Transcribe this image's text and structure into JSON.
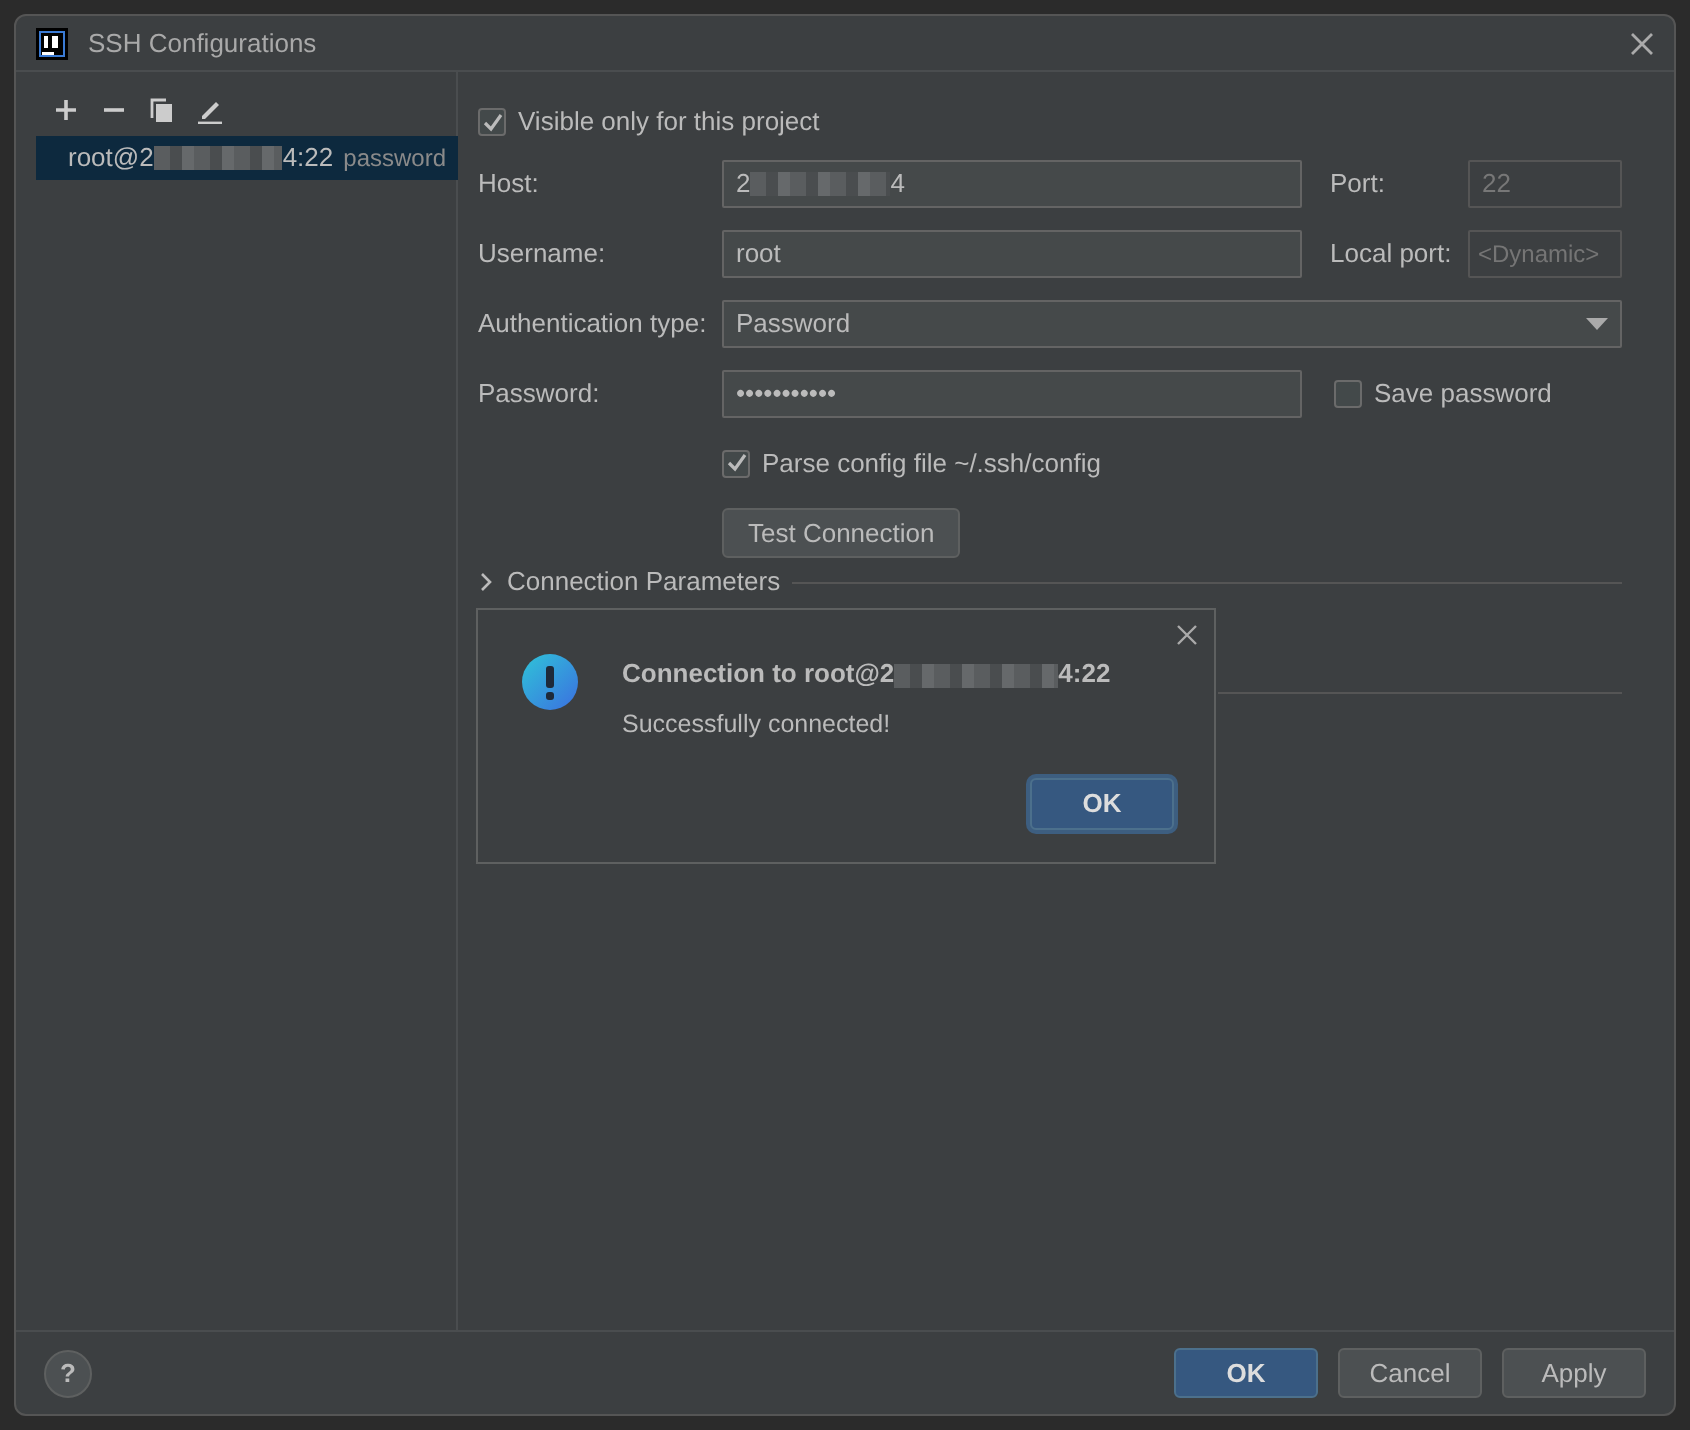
{
  "window": {
    "title": "SSH Configurations"
  },
  "toolbar": [
    {
      "kind": "add"
    },
    {
      "kind": "remove"
    },
    {
      "kind": "copy"
    },
    {
      "kind": "edit"
    }
  ],
  "configs": [
    {
      "prefix": "root@2",
      "suffix": "4:22",
      "auth": "password",
      "selected": true
    }
  ],
  "visible_only": {
    "label": "Visible only for this project",
    "checked": true
  },
  "host": {
    "label": "Host:",
    "prefix": "2",
    "suffix": "4"
  },
  "port": {
    "label": "Port:",
    "value": "22",
    "disabled": true
  },
  "username": {
    "label": "Username:",
    "value": "root"
  },
  "local_port": {
    "label": "Local port:",
    "placeholder": "<Dynamic>"
  },
  "auth_type": {
    "label": "Authentication type:",
    "value": "Password"
  },
  "password": {
    "label": "Password:",
    "value": "•••••••••••"
  },
  "save_password": {
    "label": "Save password",
    "checked": false
  },
  "parse_config": {
    "label": "Parse config file ~/.ssh/config",
    "checked": true
  },
  "test_button": "Test Connection",
  "sections": [
    {
      "title": "Connection Parameters",
      "expanded": false
    }
  ],
  "popup": {
    "title_prefix": "Connection to root@2",
    "title_suffix": "4:22",
    "message": "Successfully connected!",
    "button": "OK"
  },
  "footer": {
    "help": "?",
    "buttons": [
      {
        "label": "OK",
        "primary": true
      },
      {
        "label": "Cancel",
        "primary": false
      },
      {
        "label": "Apply",
        "primary": false
      }
    ]
  }
}
